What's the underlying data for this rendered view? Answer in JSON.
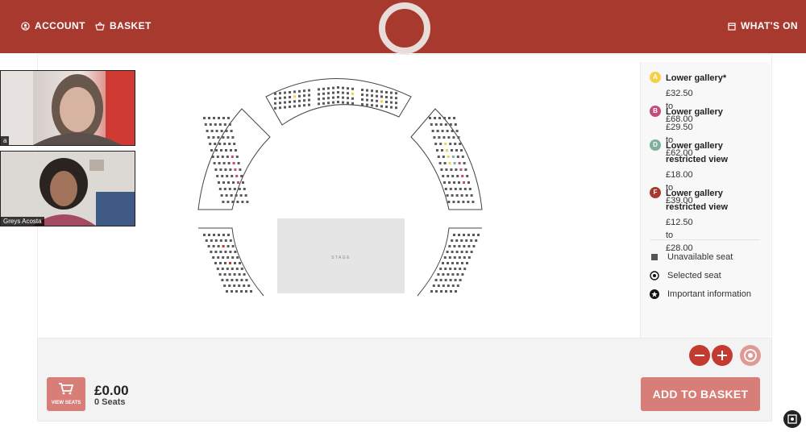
{
  "header": {
    "account_label": "ACCOUNT",
    "basket_label": "BASKET",
    "whats_on_label": "WHAT'S ON"
  },
  "video_tiles": [
    {
      "name": "a"
    },
    {
      "name": "Greys Acosta"
    }
  ],
  "seat_map": {
    "stage_label": "STAGE"
  },
  "legend": {
    "sections": [
      {
        "badge": "A",
        "color": "#f2d24a",
        "name": "Lower gallery*",
        "price": "£32.50 to £68.00"
      },
      {
        "badge": "B",
        "color": "#c24c7a",
        "name": "Lower gallery",
        "price": "£29.50 to £62.00"
      },
      {
        "badge": "D",
        "color": "#7fb09a",
        "name": "Lower gallery restricted view",
        "price": "£18.00 to £39.00"
      },
      {
        "badge": "F",
        "color": "#a8392f",
        "name": "Lower gallery restricted view",
        "price": "£12.50 to £28.00"
      }
    ],
    "keys": [
      {
        "icon": "unavailable-seat-icon",
        "label": "Unavailable seat"
      },
      {
        "icon": "selected-seat-icon",
        "label": "Selected seat"
      },
      {
        "icon": "important-info-icon",
        "label": "Important information"
      }
    ]
  },
  "footer": {
    "view_seats_label": "VIEW SEATS",
    "total_price": "£0.00",
    "seat_count": "0 Seats",
    "add_to_basket_label": "ADD TO BASKET"
  },
  "colors": {
    "brand_red": "#a8392f",
    "button_pink": "#d87e78"
  }
}
